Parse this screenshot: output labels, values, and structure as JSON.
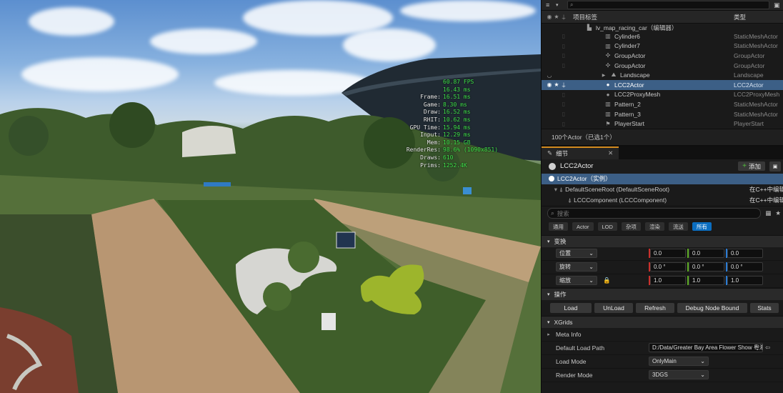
{
  "stats": [
    {
      "k": "",
      "v": "60.87 FPS"
    },
    {
      "k": "",
      "v": "16.43 ms"
    },
    {
      "k": "Frame:",
      "v": "16.51 ms"
    },
    {
      "k": "Game:",
      "v": "8.30 ms"
    },
    {
      "k": "Draw:",
      "v": "16.52 ms"
    },
    {
      "k": "RHIT:",
      "v": "10.62 ms"
    },
    {
      "k": "GPU Time:",
      "v": "15.94 ms"
    },
    {
      "k": "Input:",
      "v": "12.29 ms"
    },
    {
      "k": "Mem:",
      "v": "10.15 GB"
    },
    {
      "k": "RenderRes:",
      "v": "98.6% (1090x851)"
    },
    {
      "k": "Draws:",
      "v": "610"
    },
    {
      "k": "Prims:",
      "v": "1252.4K"
    }
  ],
  "outliner": {
    "col_label": "项目标签",
    "col_type": "类型",
    "level": "lv_map_racing_car（编辑器）",
    "rows": [
      {
        "label": "Cylinder6",
        "type": "StaticMeshActor",
        "icon": "mesh-icon",
        "sel": false
      },
      {
        "label": "Cylinder7",
        "type": "StaticMeshActor",
        "icon": "mesh-icon",
        "sel": false
      },
      {
        "label": "GroupActor",
        "type": "GroupActor",
        "icon": "group-icon",
        "sel": false
      },
      {
        "label": "GroupActor",
        "type": "GroupActor",
        "icon": "group-icon",
        "sel": false
      },
      {
        "label": "Landscape",
        "type": "Landscape",
        "icon": "landscape-icon",
        "sel": false
      },
      {
        "label": "LCC2Actor",
        "type": "LCC2Actor",
        "icon": "actor-icon",
        "sel": true
      },
      {
        "label": "LCC2ProxyMesh",
        "type": "LCC2ProxyMesh",
        "icon": "actor-icon",
        "sel": false
      },
      {
        "label": "Pattern_2",
        "type": "StaticMeshActor",
        "icon": "mesh-icon",
        "sel": false
      },
      {
        "label": "Pattern_3",
        "type": "StaticMeshActor",
        "icon": "mesh-icon",
        "sel": false
      },
      {
        "label": "PlayerStart",
        "type": "PlayerStart",
        "icon": "flag-icon",
        "sel": false
      }
    ],
    "footer": "100个Actor（已选1个）"
  },
  "details": {
    "tab": "细节",
    "actor_name": "LCC2Actor",
    "add_button": "添加",
    "instance_label": "LCC2Actor（实例）",
    "components": [
      {
        "label": "DefaultSceneRoot (DefaultSceneRoot)",
        "right": "在C++中编辑"
      },
      {
        "label": "LCCComponent (LCCComponent)",
        "right": "在C++中编辑"
      }
    ],
    "search_placeholder": "搜索",
    "filter_tabs": [
      "通用",
      "Actor",
      "LOD",
      "杂项",
      "渲染",
      "流送",
      "所有"
    ],
    "active_filter": 6,
    "transform_title": "变换",
    "transform": [
      {
        "label": "位置",
        "x": "0.0",
        "y": "0.0",
        "z": "0.0"
      },
      {
        "label": "旋转",
        "x": "0.0 °",
        "y": "0.0 °",
        "z": "0.0 °"
      },
      {
        "label": "缩放",
        "x": "1.0",
        "y": "1.0",
        "z": "1.0"
      }
    ],
    "actions_title": "操作",
    "actions": [
      "Load",
      "UnLoad",
      "Refresh",
      "Debug Node Bound",
      "Stats"
    ],
    "xgrids_title": "XGrids",
    "meta_info": "Meta Info",
    "default_load_path_label": "Default Load Path",
    "default_load_path": "D:/Data/Greater Bay Area Flower Show 粤港",
    "load_mode_label": "Load Mode",
    "load_mode": "OnlyMain",
    "render_mode_label": "Render Mode",
    "render_mode": "3DGS"
  }
}
